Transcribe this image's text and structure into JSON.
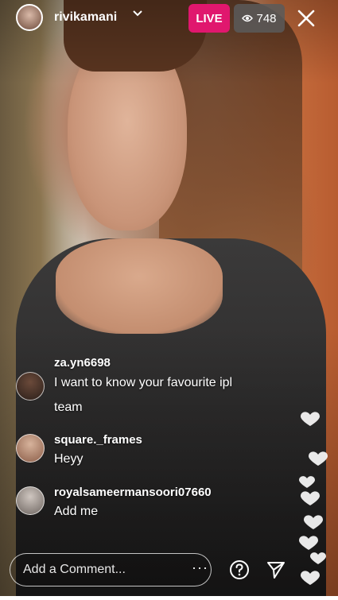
{
  "header": {
    "username": "rivikamani",
    "live_label": "LIVE",
    "viewer_count": "748",
    "icons": {
      "viewers": "eye-icon",
      "close": "close-icon",
      "dropdown": "chevron-down-icon"
    }
  },
  "comments": [
    {
      "user": "za.yn6698",
      "text_lines": [
        "I want to know your favourite ipl",
        "team"
      ]
    },
    {
      "user": "square._frames",
      "text_lines": [
        "Heyy"
      ]
    },
    {
      "user": "royalsameermansoori07660",
      "text_lines": [
        "Add me"
      ]
    }
  ],
  "footer": {
    "comment_placeholder": "Add a Comment...",
    "more_label": "···",
    "icons": {
      "question": "question-icon",
      "send": "send-icon",
      "hearts": "heart-icon"
    }
  },
  "colors": {
    "live_badge": "#e0176e",
    "viewer_badge": "#5a5a5a"
  }
}
